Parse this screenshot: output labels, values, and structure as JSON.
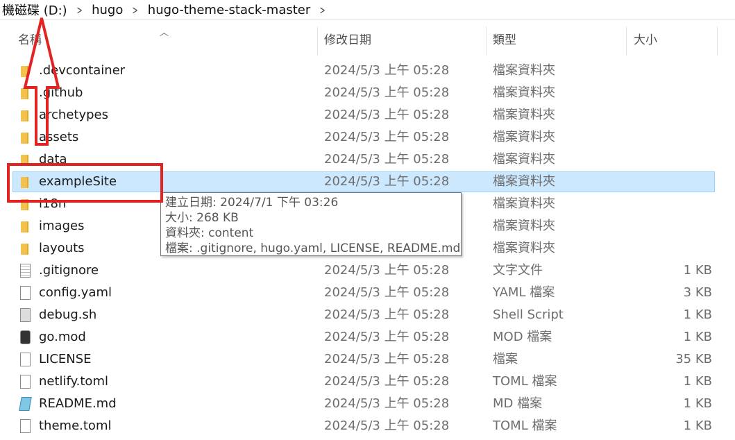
{
  "breadcrumb": {
    "items": [
      "機磁碟 (D:)",
      "hugo",
      "hugo-theme-stack-master"
    ]
  },
  "columns": {
    "name": "名稱",
    "date": "修改日期",
    "type": "類型",
    "size": "大小"
  },
  "files": [
    {
      "name": ".devcontainer",
      "date": "2024/5/3 上午 05:28",
      "type": "檔案資料夾",
      "size": "",
      "icon": "folder-icon"
    },
    {
      "name": ".github",
      "date": "2024/5/3 上午 05:28",
      "type": "檔案資料夾",
      "size": "",
      "icon": "folder-icon"
    },
    {
      "name": "archetypes",
      "date": "2024/5/3 上午 05:28",
      "type": "檔案資料夾",
      "size": "",
      "icon": "folder-icon"
    },
    {
      "name": "assets",
      "date": "2024/5/3 上午 05:28",
      "type": "檔案資料夾",
      "size": "",
      "icon": "folder-icon"
    },
    {
      "name": "data",
      "date": "2024/5/3 上午 05:28",
      "type": "檔案資料夾",
      "size": "",
      "icon": "folder-icon"
    },
    {
      "name": "exampleSite",
      "date": "2024/5/3 上午 05:28",
      "type": "檔案資料夾",
      "size": "",
      "icon": "folder-icon",
      "selected": true
    },
    {
      "name": "i18n",
      "date": "",
      "type": "檔案資料夾",
      "size": "",
      "icon": "folder-icon"
    },
    {
      "name": "images",
      "date": "",
      "type": "檔案資料夾",
      "size": "",
      "icon": "folder-icon"
    },
    {
      "name": "layouts",
      "date": "",
      "type": "檔案資料夾",
      "size": "",
      "icon": "folder-icon"
    },
    {
      "name": ".gitignore",
      "date": "2024/5/3 上午 05:28",
      "type": "文字文件",
      "size": "1 KB",
      "icon": "text-file-icon"
    },
    {
      "name": "config.yaml",
      "date": "2024/5/3 上午 05:28",
      "type": "YAML 檔案",
      "size": "3 KB",
      "icon": "file-icon"
    },
    {
      "name": "debug.sh",
      "date": "2024/5/3 上午 05:28",
      "type": "Shell Script",
      "size": "1 KB",
      "icon": "script-file-icon"
    },
    {
      "name": "go.mod",
      "date": "2024/5/3 上午 05:28",
      "type": "MOD 檔案",
      "size": "1 KB",
      "icon": "media-file-icon"
    },
    {
      "name": "LICENSE",
      "date": "2024/5/3 上午 05:28",
      "type": "檔案",
      "size": "35 KB",
      "icon": "file-icon"
    },
    {
      "name": "netlify.toml",
      "date": "2024/5/3 上午 05:28",
      "type": "TOML 檔案",
      "size": "1 KB",
      "icon": "file-icon"
    },
    {
      "name": "README.md",
      "date": "2024/5/3 上午 05:28",
      "type": "MD 檔案",
      "size": "1 KB",
      "icon": "markdown-file-icon"
    },
    {
      "name": "theme.toml",
      "date": "2024/5/3 上午 05:28",
      "type": "TOML 檔案",
      "size": "1 KB",
      "icon": "file-icon"
    }
  ],
  "tooltip": {
    "created": "建立日期: 2024/7/1 下午 03:26",
    "size": "大小: 268 KB",
    "folders": "資料夾: content",
    "files": "檔案: .gitignore, hugo.yaml, LICENSE, README.md"
  },
  "colors": {
    "selection_bg": "#cce8ff",
    "selection_border": "#99d1ff",
    "annotation_red": "#e32222",
    "folder_yellow": "#f2c14e"
  }
}
